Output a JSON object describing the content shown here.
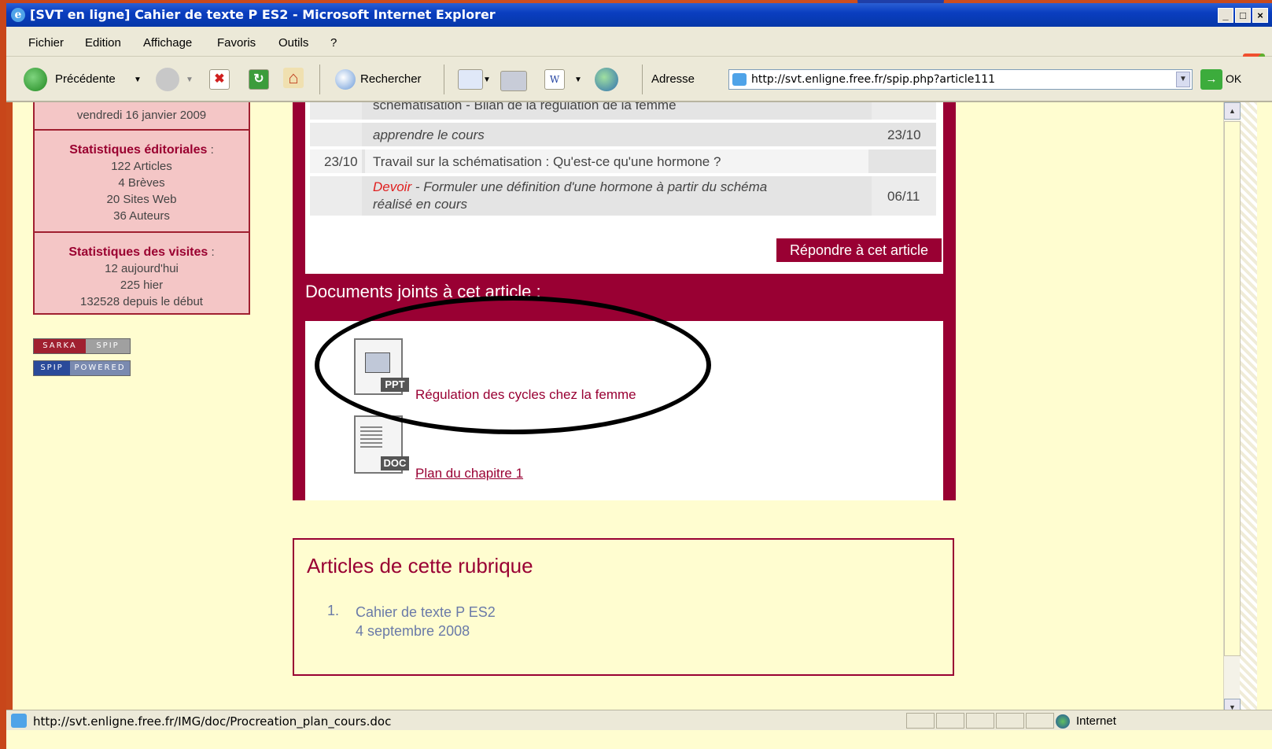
{
  "window": {
    "title": "[SVT en ligne] Cahier de texte P ES2 - Microsoft Internet Explorer",
    "min": "_",
    "max": "□",
    "close": "×"
  },
  "menu": [
    "Fichier",
    "Edition",
    "Affichage",
    "Favoris",
    "Outils",
    "?"
  ],
  "toolbar": {
    "back_label": "Précédente",
    "search_label": "Rechercher",
    "address_label": "Adresse",
    "address_value": "http://svt.enligne.free.fr/spip.php?article111",
    "go_label": "OK"
  },
  "sidebar": {
    "date": "vendredi 16 janvier 2009",
    "editorial": {
      "header": "Statistiques éditoriales",
      "lines": [
        "122 Articles",
        "4 Brèves",
        "20 Sites Web",
        "36 Auteurs"
      ]
    },
    "visits": {
      "header": "Statistiques des visites",
      "lines": [
        "12 aujourd'hui",
        "225 hier",
        "132528 depuis le début"
      ]
    },
    "badges": [
      {
        "left": "SARKA",
        "right": "SPIP"
      },
      {
        "left": "SPIP",
        "right": "POWERED"
      }
    ]
  },
  "table": {
    "rows": [
      {
        "date": "",
        "text": "schématisation - Bilan de la régulation de la femme",
        "due": ""
      },
      {
        "date": "",
        "text": "apprendre le cours",
        "due": "23/10"
      },
      {
        "date": "23/10",
        "text": "Travail sur la schématisation : Qu'est-ce qu'une hormone ?",
        "due": ""
      },
      {
        "date": "",
        "prefix": "Devoir",
        "text": " - Formuler une définition d'une hormone à partir du schéma",
        "text2": "réalisé en cours",
        "due": "06/11"
      }
    ]
  },
  "reply_button": "Répondre à cet article",
  "documents": {
    "title": "Documents joints à cet article :",
    "items": [
      {
        "type": "PPT",
        "label": "Régulation des cycles chez la femme"
      },
      {
        "type": "DOC",
        "label": "Plan du chapitre 1"
      }
    ]
  },
  "rubrique": {
    "title": "Articles de cette rubrique",
    "number": "1.",
    "item_title": "Cahier de texte P ES2",
    "item_date": "4 septembre 2008"
  },
  "statusbar": {
    "url": "http://svt.enligne.free.fr/IMG/doc/Procreation_plan_cours.doc",
    "zone": "Internet"
  },
  "colors": {
    "accent": "#990033",
    "page_bg": "#fffdd0",
    "sidebar_bg": "#f4c6c6",
    "link": "#6a7aa8"
  }
}
